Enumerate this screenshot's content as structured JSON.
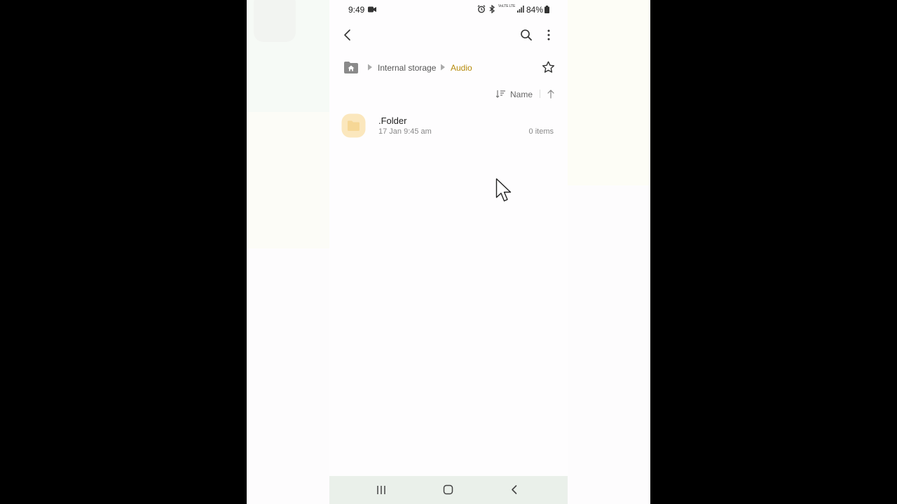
{
  "status_bar": {
    "time": "9:49",
    "battery": "84%",
    "icons": [
      "video-record-icon",
      "alarm-icon",
      "bluetooth-icon",
      "volte-icon",
      "lte-icon",
      "signal-icon",
      "battery-icon"
    ],
    "volte_label": "VoLTE",
    "lte_label": "LTE"
  },
  "toolbar": {
    "back_icon": "back-arrow-icon",
    "search_icon": "search-icon",
    "more_icon": "more-vertical-icon"
  },
  "breadcrumb": {
    "items": [
      {
        "label": "Internal storage"
      },
      {
        "label": "Audio"
      }
    ],
    "active_color": "#b58a0a"
  },
  "sort": {
    "label": "Name"
  },
  "files": [
    {
      "name": ".Folder",
      "date": "17 Jan 9:45 am",
      "count": "0 items"
    }
  ],
  "colors": {
    "folder": "#f6c86a",
    "accent": "#b58a0a"
  }
}
